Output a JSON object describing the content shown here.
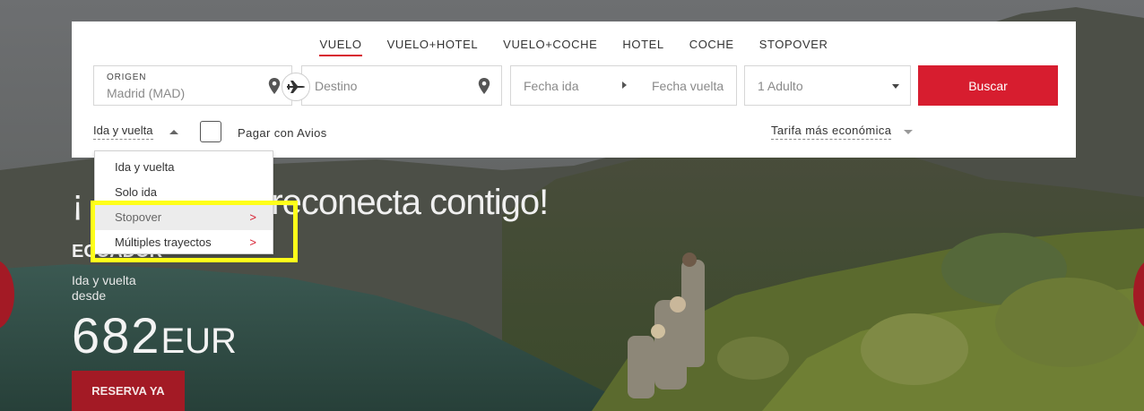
{
  "tabs": [
    {
      "label": "VUELO",
      "active": true
    },
    {
      "label": "VUELO+HOTEL",
      "active": false
    },
    {
      "label": "VUELO+COCHE",
      "active": false
    },
    {
      "label": "HOTEL",
      "active": false
    },
    {
      "label": "COCHE",
      "active": false
    },
    {
      "label": "STOPOVER",
      "active": false
    }
  ],
  "search": {
    "origin_label": "ORIGEN",
    "origin_value": "Madrid (MAD)",
    "destination_placeholder": "Destino",
    "departure_placeholder": "Fecha ida",
    "return_placeholder": "Fecha vuelta",
    "passengers": "1 Adulto",
    "search_button": "Buscar",
    "trip_type": "Ida y vuelta",
    "pay_with_avios": "Pagar con Avios",
    "fare_type": "Tarifa más económica"
  },
  "trip_dropdown": {
    "items": [
      {
        "label": "Ida y vuelta",
        "arrow": ""
      },
      {
        "label": "Solo ida",
        "arrow": ""
      },
      {
        "label": "Stopover",
        "arrow": ">"
      },
      {
        "label": "Múltiples trayectos",
        "arrow": ">"
      }
    ]
  },
  "promo": {
    "headline_start": "¡",
    "headline_end": "reconecta contigo!",
    "destination": "ECUADOR",
    "trip": "Ida y vuelta",
    "from": "desde",
    "price": "682",
    "currency": "EUR",
    "cta": "RESERVA YA"
  },
  "colors": {
    "accent": "#d71d2f",
    "cta": "#a31a25",
    "highlight": "#ffff1a"
  },
  "icons": [
    "location-pin-icon",
    "plane-swap-icon",
    "chevron-down-icon",
    "chevron-right-icon"
  ]
}
